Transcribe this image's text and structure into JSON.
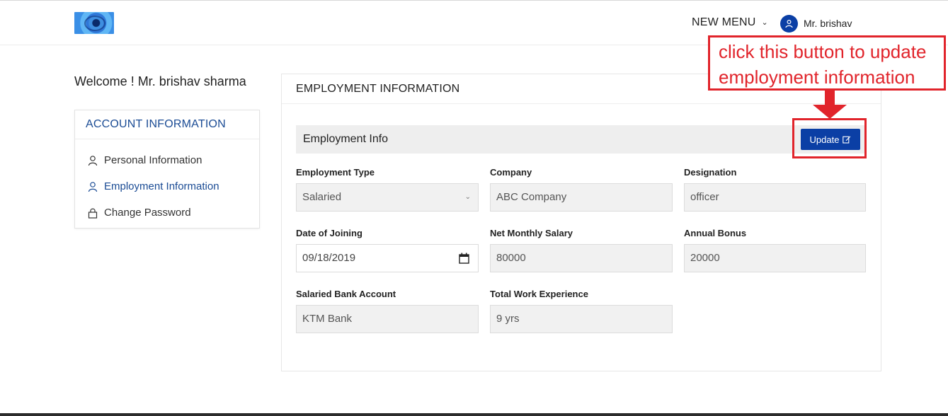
{
  "header": {
    "menu_label": "NEW MENU",
    "user_name": "Mr. brishav"
  },
  "sidebar": {
    "welcome": "Welcome ! Mr. brishav sharma",
    "title": "ACCOUNT INFORMATION",
    "items": [
      {
        "label": "Personal Information",
        "icon": "user-icon",
        "active": false
      },
      {
        "label": "Employment Information",
        "icon": "user-icon",
        "active": true
      },
      {
        "label": "Change Password",
        "icon": "lock-icon",
        "active": false
      }
    ]
  },
  "main": {
    "title": "EMPLOYMENT INFORMATION",
    "section_title": "Employment Info",
    "update_label": "Update",
    "fields": {
      "employment_type": {
        "label": "Employment Type",
        "value": "Salaried"
      },
      "company": {
        "label": "Company",
        "value": "ABC Company"
      },
      "designation": {
        "label": "Designation",
        "value": "officer"
      },
      "date_of_joining": {
        "label": "Date of Joining",
        "value": "09/18/2019"
      },
      "net_monthly_salary": {
        "label": "Net Monthly Salary",
        "value": "80000"
      },
      "annual_bonus": {
        "label": "Annual Bonus",
        "value": "20000"
      },
      "salaried_bank_account": {
        "label": "Salaried Bank Account",
        "value": "KTM Bank"
      },
      "total_work_experience": {
        "label": "Total Work Experience",
        "value": "9 yrs"
      }
    }
  },
  "annotation": {
    "text": "click this button to update employment information"
  },
  "colors": {
    "primary": "#0b3fa5",
    "link": "#1a4b94",
    "annotation": "#e1242b"
  }
}
